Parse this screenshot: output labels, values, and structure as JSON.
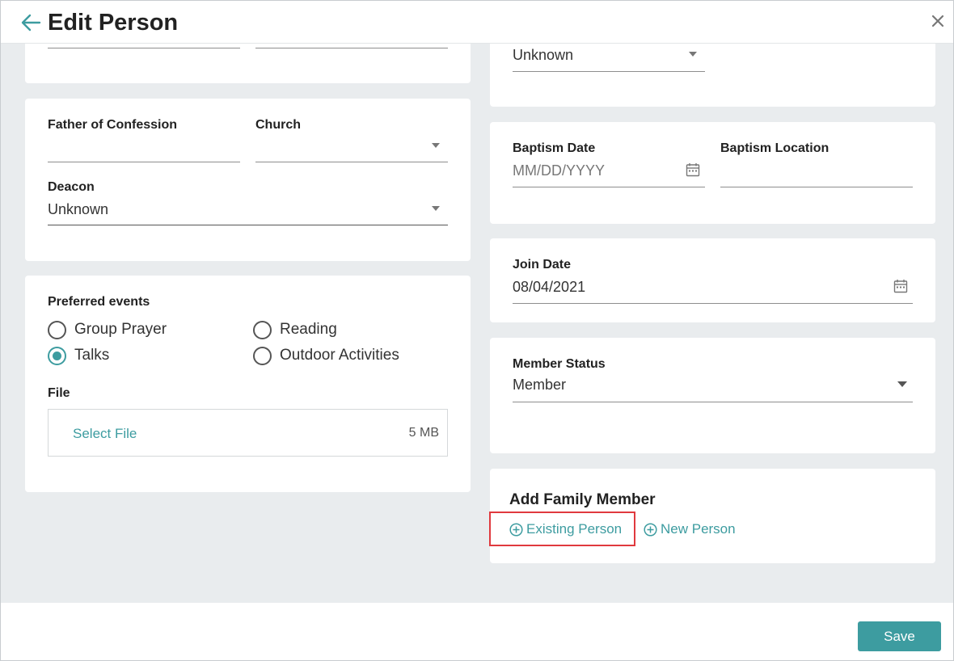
{
  "header": {
    "title": "Edit Person"
  },
  "left": {
    "card2": {
      "father_label": "Father of Confession",
      "church_label": "Church",
      "deacon_label": "Deacon",
      "deacon_value": "Unknown"
    },
    "card3": {
      "preferred_label": "Preferred events",
      "options": [
        {
          "label": "Group Prayer",
          "checked": false
        },
        {
          "label": "Reading",
          "checked": false
        },
        {
          "label": "Talks",
          "checked": true
        },
        {
          "label": "Outdoor Activities",
          "checked": false
        }
      ],
      "file_label": "File",
      "select_file": "Select File",
      "file_size": "5 MB"
    }
  },
  "right": {
    "card1": {
      "value": "Unknown"
    },
    "baptism": {
      "date_label": "Baptism Date",
      "date_placeholder": "MM/DD/YYYY",
      "location_label": "Baptism Location"
    },
    "join": {
      "label": "Join Date",
      "value": "08/04/2021"
    },
    "member": {
      "label": "Member Status",
      "value": "Member"
    },
    "family": {
      "title": "Add Family Member",
      "existing": "Existing Person",
      "new": "New Person"
    }
  },
  "footer": {
    "save": "Save"
  },
  "colors": {
    "accent": "#3d9ca0",
    "highlight": "#e0393e",
    "background": "#e9ecee"
  },
  "icons": [
    "back-arrow-icon",
    "close-icon",
    "calendar-icon",
    "plus-circle-icon",
    "dropdown-caret-icon"
  ]
}
